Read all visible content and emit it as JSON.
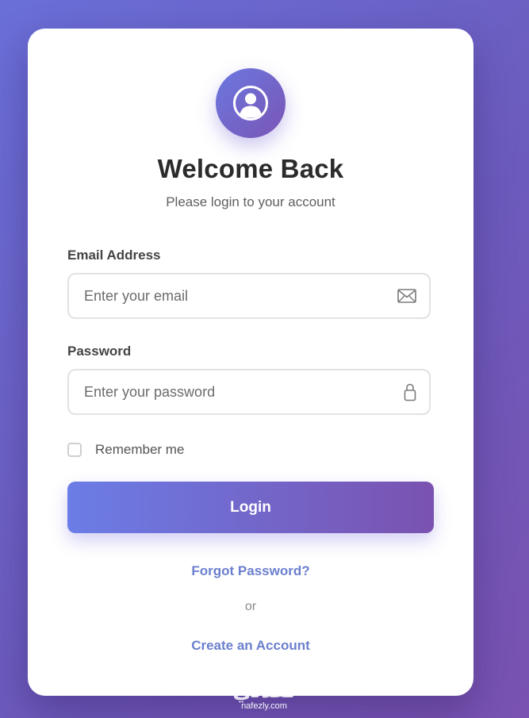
{
  "login": {
    "title": "Welcome Back",
    "subtitle": "Please login to your account",
    "avatar_icon": "user-circle-icon",
    "email": {
      "label": "Email Address",
      "placeholder": "Enter your email",
      "value": "",
      "icon": "envelope-icon"
    },
    "password": {
      "label": "Password",
      "placeholder": "Enter your password",
      "value": "",
      "icon": "lock-icon"
    },
    "remember": {
      "label": "Remember me",
      "checked": false
    },
    "submit_label": "Login",
    "forgot_label": "Forgot Password?",
    "or_label": "or",
    "create_label": "Create an Account"
  },
  "watermark": {
    "arabic": "نفذلي",
    "latin": "nafezly.com"
  },
  "colors": {
    "background_start": "#6a6fd8",
    "background_end": "#7a52b0",
    "accent_start": "#6b7de6",
    "accent_end": "#7a52b0",
    "link": "#6b7fce",
    "title": "#2b2b2b"
  }
}
